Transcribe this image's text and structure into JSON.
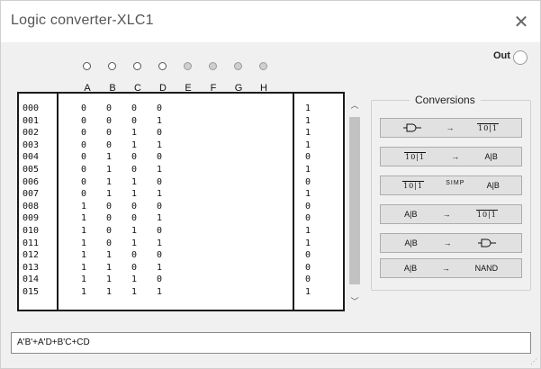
{
  "window": {
    "title": "Logic converter-XLC1",
    "close_glyph": "✕"
  },
  "output": {
    "label": "Out"
  },
  "inputs": [
    "A",
    "B",
    "C",
    "D",
    "E",
    "F",
    "G",
    "H"
  ],
  "input_active": [
    true,
    true,
    true,
    true,
    false,
    false,
    false,
    false
  ],
  "truth_table": {
    "rows": [
      {
        "index": "000",
        "a": "0",
        "b": "0",
        "c": "0",
        "d": "0",
        "out": "1"
      },
      {
        "index": "001",
        "a": "0",
        "b": "0",
        "c": "0",
        "d": "1",
        "out": "1"
      },
      {
        "index": "002",
        "a": "0",
        "b": "0",
        "c": "1",
        "d": "0",
        "out": "1"
      },
      {
        "index": "003",
        "a": "0",
        "b": "0",
        "c": "1",
        "d": "1",
        "out": "1"
      },
      {
        "index": "004",
        "a": "0",
        "b": "1",
        "c": "0",
        "d": "0",
        "out": "0"
      },
      {
        "index": "005",
        "a": "0",
        "b": "1",
        "c": "0",
        "d": "1",
        "out": "1"
      },
      {
        "index": "006",
        "a": "0",
        "b": "1",
        "c": "1",
        "d": "0",
        "out": "0"
      },
      {
        "index": "007",
        "a": "0",
        "b": "1",
        "c": "1",
        "d": "1",
        "out": "1"
      },
      {
        "index": "008",
        "a": "1",
        "b": "0",
        "c": "0",
        "d": "0",
        "out": "0"
      },
      {
        "index": "009",
        "a": "1",
        "b": "0",
        "c": "0",
        "d": "1",
        "out": "0"
      },
      {
        "index": "010",
        "a": "1",
        "b": "0",
        "c": "1",
        "d": "0",
        "out": "1"
      },
      {
        "index": "011",
        "a": "1",
        "b": "0",
        "c": "1",
        "d": "1",
        "out": "1"
      },
      {
        "index": "012",
        "a": "1",
        "b": "1",
        "c": "0",
        "d": "0",
        "out": "0"
      },
      {
        "index": "013",
        "a": "1",
        "b": "1",
        "c": "0",
        "d": "1",
        "out": "0"
      },
      {
        "index": "014",
        "a": "1",
        "b": "1",
        "c": "1",
        "d": "0",
        "out": "0"
      },
      {
        "index": "015",
        "a": "1",
        "b": "1",
        "c": "1",
        "d": "1",
        "out": "1"
      }
    ]
  },
  "conversions": {
    "title": "Conversions",
    "buttons": [
      {
        "from": "circuit-icon",
        "arrow": "→",
        "to": "10|1"
      },
      {
        "from": "10|1",
        "arrow": "→",
        "to": "A|B"
      },
      {
        "from": "10|1",
        "arrow": "SIMP",
        "to": "A|B"
      },
      {
        "from": "A|B",
        "arrow": "→",
        "to": "10|1"
      },
      {
        "from": "A|B",
        "arrow": "→",
        "to": "circuit-icon"
      },
      {
        "from": "A|B",
        "arrow": "→",
        "to": "NAND"
      }
    ]
  },
  "expression": "A'B'+A'D+B'C+CD",
  "colors": {
    "window_bg": "#f0f0f0",
    "button_bg": "#e1e1e1",
    "border_dark": "#1a1a1a"
  }
}
